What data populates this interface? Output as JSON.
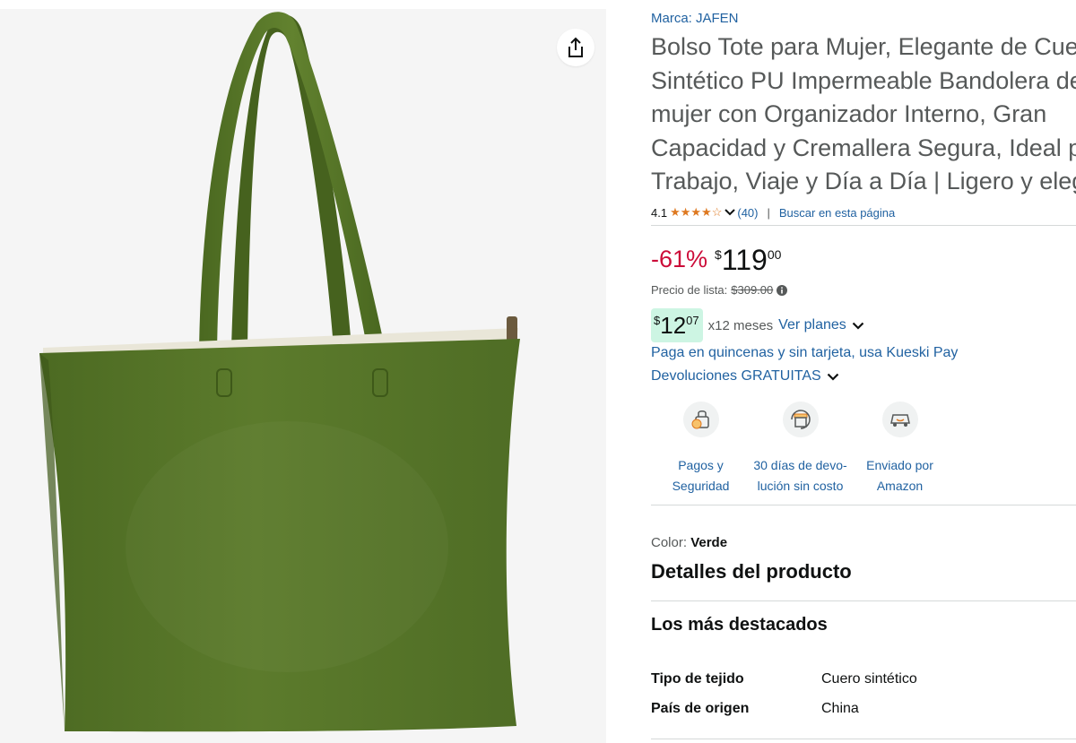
{
  "product": {
    "brand": "Marca: JAFEN",
    "title_lines": [
      "Bolso Tote para Mujer, Elegante de Cuero",
      "Sintético PU Impermeable Bandolera de",
      "mujer con Organizador Interno, Gran",
      "Capacidad y Cremallera Segura, Ideal para",
      "Trabajo, Viaje y Día a Día | Ligero y elegante"
    ],
    "rating": "4.1",
    "rating_value": 4.1,
    "review_count": "(40)",
    "search_link": "Buscar en esta página",
    "discount": "-61%",
    "price_currency": "$",
    "price_whole": "119",
    "price_fraction": "00",
    "list_price_label": "Precio de lista:",
    "list_price": "$309.00",
    "monthly_currency": "$",
    "monthly_whole": "12",
    "monthly_fraction": "07",
    "months": "x12 meses",
    "plans_link": "Ver planes",
    "kueski_link": "Paga en quincenas y sin tarjeta, usa Kueski Pay",
    "returns_link": "Devoluciones GRATUITAS",
    "features": [
      {
        "line1": "Pagos y",
        "line2": "Seguridad",
        "icon": "secure-payment-icon"
      },
      {
        "line1": "30 días de devo-",
        "line2": "lución sin costo",
        "icon": "return-box-icon"
      },
      {
        "line1": "Enviado por",
        "line2": "Amazon",
        "icon": "delivery-truck-icon"
      }
    ],
    "color_label": "Color:",
    "color_value": "Verde",
    "details_title": "Detalles del producto",
    "highlights_title": "Los más destacados",
    "specs": [
      {
        "key": "Tipo de tejido",
        "value": "Cuero sintético"
      },
      {
        "key": "País de origen",
        "value": "China"
      }
    ]
  },
  "colors": {
    "link": "#2162a1",
    "discount": "#cc0c39",
    "star": "#de7921",
    "badge_bg": "#cdf5e3",
    "bag_green": "#5a7a2b"
  }
}
